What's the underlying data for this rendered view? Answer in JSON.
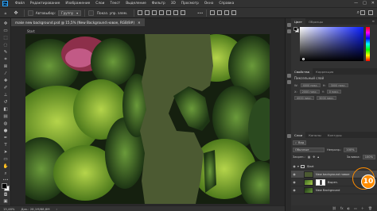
{
  "menu": {
    "logo": "Ps",
    "items": [
      "Файл",
      "Редактирование",
      "Изображение",
      "Слои",
      "Текст",
      "Выделение",
      "Фильтр",
      "3D",
      "Просмотр",
      "Окно",
      "Справка"
    ],
    "window_controls": [
      "—",
      "□",
      "✕"
    ]
  },
  "options": {
    "autoselect_label": "Автовыбор:",
    "autoselect_value": "Группу",
    "transform_label": "Показ. упр. элем."
  },
  "document": {
    "tab_title": "make new background.psd @ 15,5% (New Background новое, RGB/8#)",
    "close_glyph": "✕",
    "artboard_label": "Start"
  },
  "status": {
    "zoom": "15,46%",
    "doc_info": "Док.: 28,1М/88,8M"
  },
  "color_panel": {
    "tabs": [
      "Цвет",
      "Образцы"
    ],
    "menu_glyph": "≡"
  },
  "properties_panel": {
    "tabs": [
      "Свойства",
      "Коррекция"
    ],
    "title": "Пиксельный слой",
    "rows": [
      {
        "label": "W:",
        "value": "4000 пикс.",
        "label2": "H:",
        "value2": "3000 пикс."
      },
      {
        "label": "X:",
        "value": "2000 пикс.",
        "label2": "Y:",
        "value2": "0 пикс."
      },
      {
        "label": "",
        "value": "4000 пикс.",
        "label2": "",
        "value2": "3000 пикс."
      }
    ]
  },
  "layers_panel": {
    "tabs": [
      "Слои",
      "Каналы",
      "Контуры"
    ],
    "filter_label": "Вид",
    "blend_mode": "Обычные",
    "opacity_label": "Непрозр.:",
    "opacity_value": "100%",
    "lock_label": "Закреп.:",
    "fill_label": "Заливка:",
    "fill_value": "100%",
    "layers": [
      {
        "name": "Start",
        "type": "artboard",
        "selected": false
      },
      {
        "name": "New background новое",
        "type": "fill",
        "color": "#4c5a32",
        "selected": true
      },
      {
        "name": "Вырез.",
        "type": "masked",
        "selected": false
      },
      {
        "name": "New Background",
        "type": "image",
        "selected": false
      }
    ],
    "footer_icons": [
      "fx",
      "◐",
      "▭",
      "＋",
      "🗑"
    ]
  },
  "overlay": {
    "step_number": "10",
    "accent_color": "#ff8c00"
  },
  "colors": {
    "fill_layer": "#4c5a32",
    "ui_dark": "#323232",
    "canvas_bg": "#282828"
  }
}
